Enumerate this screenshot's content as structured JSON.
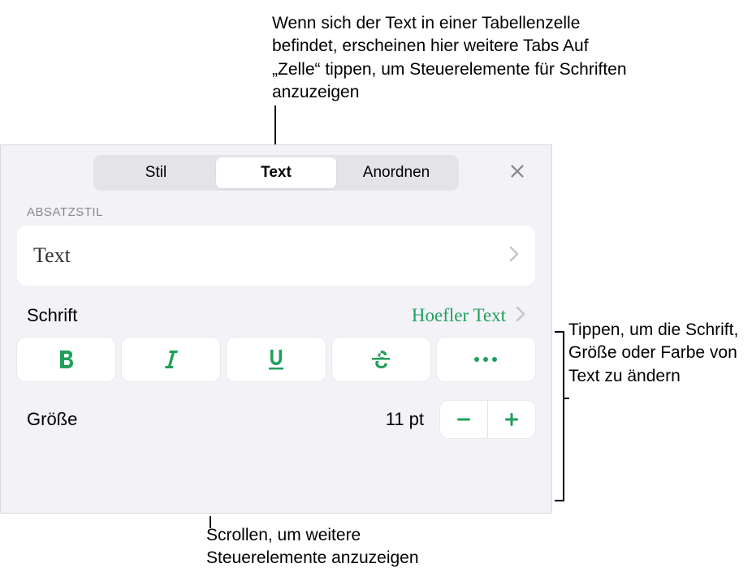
{
  "callouts": {
    "top": "Wenn sich der Text in einer Tabellenzelle befindet, erscheinen hier weitere Tabs Auf „Zelle“ tippen, um Steuerelemente für Schriften anzuzeigen",
    "right": "Tippen, um die Schrift, Größe oder Farbe von Text zu ändern",
    "bottom": "Scrollen, um weitere Steuerelemente anzuzeigen"
  },
  "tabs": {
    "stil": "Stil",
    "text": "Text",
    "anordnen": "Anordnen"
  },
  "sections": {
    "paragraph_style_label": "ABSATZSTIL"
  },
  "paragraph_style": {
    "value": "Text"
  },
  "font": {
    "label": "Schrift",
    "value": "Hoefler Text"
  },
  "size": {
    "label": "Größe",
    "value": "11 pt"
  },
  "colors": {
    "accent": "#1fa05a"
  }
}
